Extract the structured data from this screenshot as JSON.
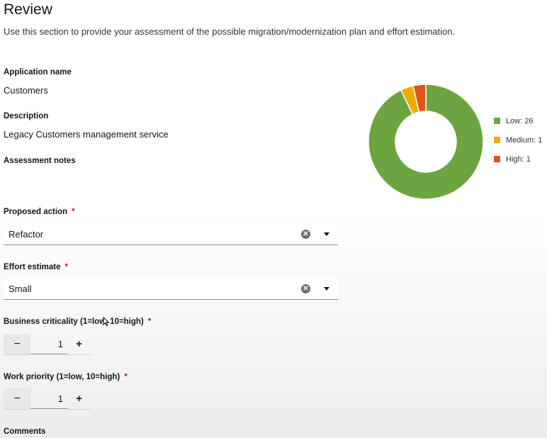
{
  "review": {
    "title": "Review",
    "subtitle": "Use this section to provide your assessment of the possible migration/modernization plan and effort estimation."
  },
  "application": {
    "name_label": "Application name",
    "name_value": "Customers"
  },
  "description": {
    "label": "Description",
    "value": "Legacy Customers management service"
  },
  "assessment_notes": {
    "label": "Assessment notes"
  },
  "proposed_action": {
    "label": "Proposed action",
    "required": "*",
    "value": "Refactor",
    "clear_glyph": "✕"
  },
  "effort_estimate": {
    "label": "Effort estimate",
    "required": "*",
    "value": "Small",
    "clear_glyph": "✕"
  },
  "business_criticality": {
    "label": "Business criticality (1=low, 10=high)",
    "required": "*",
    "value": "1",
    "minus": "−",
    "plus": "+"
  },
  "work_priority": {
    "label": "Work priority (1=low, 10=high)",
    "required": "*",
    "value": "1",
    "minus": "−",
    "plus": "+"
  },
  "comments": {
    "label": "Comments"
  },
  "chart_data": {
    "type": "pie",
    "categories": [
      "Low",
      "Medium",
      "High"
    ],
    "values": [
      26,
      1,
      1
    ],
    "labels": [
      "Low: 26",
      "Medium: 1",
      "High: 1"
    ],
    "colors": [
      "#6ca43f",
      "#f0ab00",
      "#e0521d"
    ],
    "donut": true,
    "legend": "right"
  }
}
